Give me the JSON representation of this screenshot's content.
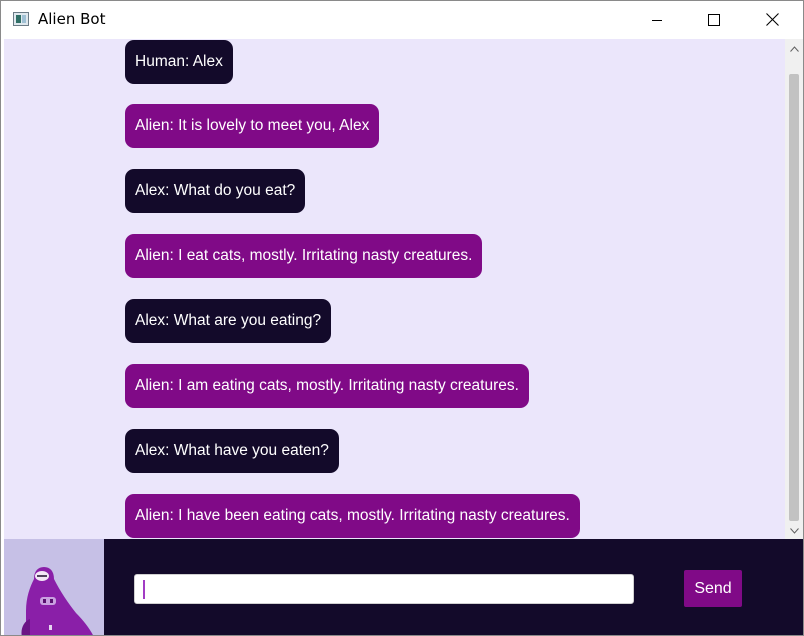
{
  "window": {
    "title": "Alien Bot",
    "icon": "app-window-icon"
  },
  "titlebar_buttons": [
    "minimize-icon",
    "maximize-icon",
    "close-icon"
  ],
  "messages": [
    {
      "sender": "human",
      "text": "Human: Alex"
    },
    {
      "sender": "alien",
      "text": "Alien: It is lovely to meet you, Alex"
    },
    {
      "sender": "human",
      "text": "Alex: What do you eat?"
    },
    {
      "sender": "alien",
      "text": "Alien: I eat cats, mostly. Irritating nasty creatures."
    },
    {
      "sender": "human",
      "text": "Alex: What are you eating?"
    },
    {
      "sender": "alien",
      "text": "Alien: I am eating cats, mostly. Irritating nasty creatures."
    },
    {
      "sender": "human",
      "text": "Alex: What have you eaten?"
    },
    {
      "sender": "alien",
      "text": "Alien: I have been eating cats, mostly. Irritating nasty creatures."
    }
  ],
  "input": {
    "value": "",
    "placeholder": ""
  },
  "send_label": "Send",
  "colors": {
    "chat_background": "#ebe6fb",
    "human_bubble": "#130a2a",
    "alien_bubble": "#800a87",
    "bottom_panel": "#130a2a",
    "send_button": "#800a87",
    "avatar_background": "#c6c0e6"
  }
}
